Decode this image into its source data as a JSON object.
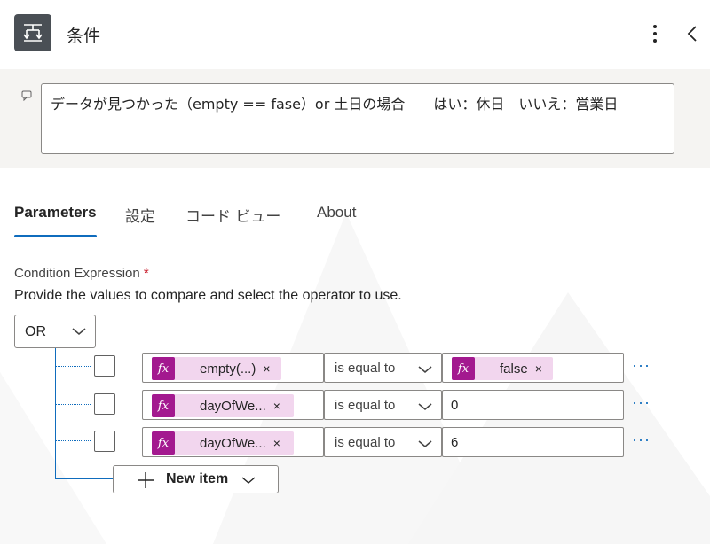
{
  "header": {
    "title": "条件",
    "icon": "condition-icon",
    "more_icon": "more-vertical-icon",
    "collapse_icon": "chevron-left-icon"
  },
  "description": {
    "value": "データが見つかった（empty == fase）or 土日の場合　　はい：休日　いいえ：営業日"
  },
  "tabs": [
    {
      "label": "Parameters",
      "active": true
    },
    {
      "label": "設定",
      "active": false
    },
    {
      "label": "コード ビュー",
      "active": false
    },
    {
      "label": "About",
      "active": false
    }
  ],
  "condition": {
    "label": "Condition Expression",
    "required_marker": "*",
    "help_text": "Provide the values to compare and select the operator to use.",
    "group_operator": "OR",
    "rows": [
      {
        "left_token": "empty(...)",
        "operator": "is equal to",
        "right_token": "false",
        "right_value": ""
      },
      {
        "left_token": "dayOfWe...",
        "operator": "is equal to",
        "right_token": "",
        "right_value": "0"
      },
      {
        "left_token": "dayOfWe...",
        "operator": "is equal to",
        "right_token": "",
        "right_value": "6"
      }
    ],
    "new_item_label": "New item",
    "fx_label": "fx",
    "remove_glyph": "×",
    "more_glyph": "···"
  },
  "colors": {
    "accent": "#0f6cbd",
    "token_bg": "#f2d6ee",
    "fx_bg": "#a3198f",
    "header_icon_bg": "#4a4f55"
  }
}
